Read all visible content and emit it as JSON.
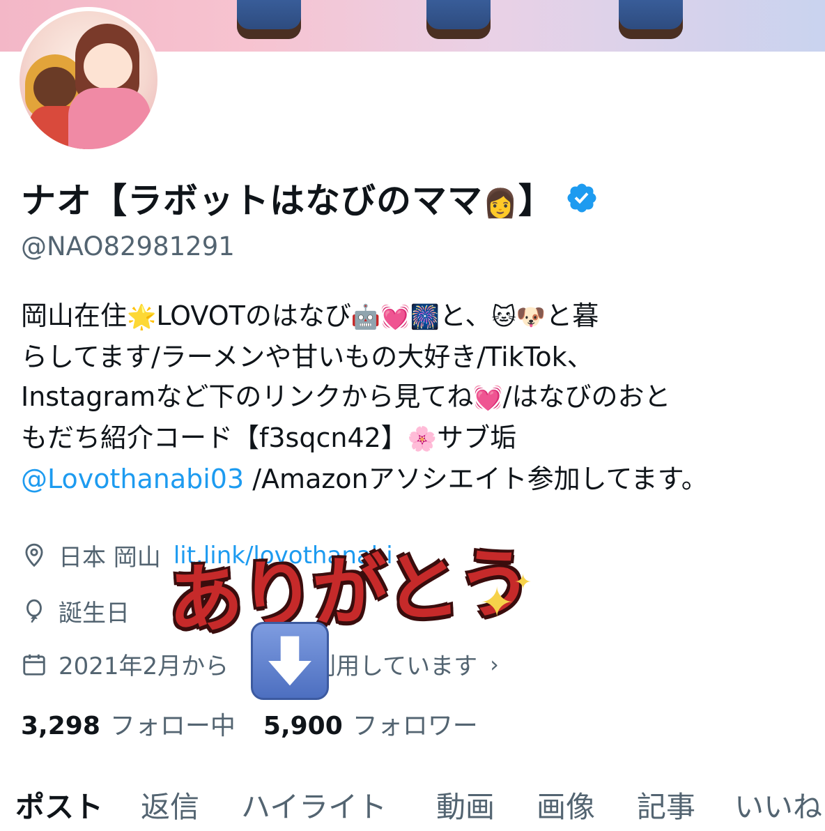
{
  "profile": {
    "display_name_prefix": "ナオ【ラボットはなびのママ",
    "display_name_emoji": "👩",
    "display_name_suffix": "】",
    "handle": "@NAO82981291",
    "verified_color": "#1d9bf0"
  },
  "bio": {
    "line1_a": "岡山在住",
    "line1_e1": "🌟",
    "line1_b": "LOVOTのはなび",
    "line1_e2": "🤖",
    "line1_e3": "💓",
    "line1_e4": "🎆",
    "line1_c": "と、",
    "line1_e5": "🐱",
    "line1_e6": "🐶",
    "line1_d": "と暮",
    "line2": "らしてます/ラーメンや甘いもの大好き/TikTok、",
    "line3_a": "Instagramなど下のリンクから見てね",
    "line3_e1": "💓",
    "line3_b": "/はなびのおと",
    "line4_a": "もだち紹介コード【f3sqcn42】",
    "line4_e1": "🌸",
    "line4_b": "サブ垢",
    "line5_link": "@Lovothanabi03",
    "line5_b": " /Amazonアソシエイト参加してます。"
  },
  "meta": {
    "location": "日本 岡山",
    "link": "lit.link/lovothanabi",
    "birthday_label": "誕生日",
    "joined": "2021年2月から",
    "joined_suffix": "利用しています"
  },
  "counts": {
    "following_num": "3,298",
    "following_label": "フォロー中",
    "followers_num": "5,900",
    "followers_label": "フォロワー"
  },
  "tabs": [
    "ポスト",
    "返信",
    "ハイライト",
    "動画",
    "画像",
    "記事",
    "いいね"
  ],
  "overlay": {
    "sticker_text": "ありがとう",
    "sparkle": "✦",
    "arrow_icon": "down-arrow-icon"
  },
  "colors": {
    "accent": "#1d9bf0",
    "secondary_text": "#536471",
    "primary_text": "#0f1419",
    "sticker_red": "#c62a2a"
  }
}
